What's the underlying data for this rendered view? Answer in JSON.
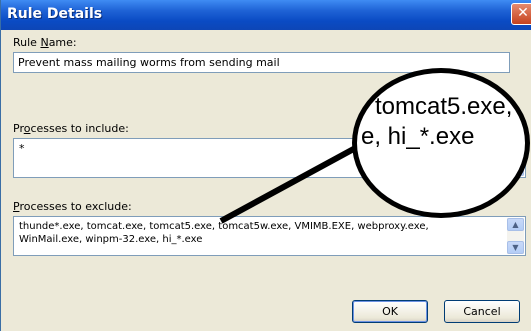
{
  "window": {
    "title": "Rule Details",
    "close_glyph": "✕"
  },
  "rule_name": {
    "label_prefix": "Rule ",
    "label_accel": "N",
    "label_suffix": "ame:",
    "value": "Prevent mass mailing worms from sending mail"
  },
  "include": {
    "label_prefix": "Pr",
    "label_accel": "o",
    "label_suffix": "cesses to include:",
    "value": "*"
  },
  "exclude": {
    "label_prefix": "",
    "label_accel": "P",
    "label_suffix": "rocesses to exclude:",
    "line1": "thunde*.exe, tomcat.exe, tomcat5.exe, tomcat5w.exe, VMIMB.EXE, webproxy.exe,",
    "line2": "WinMail.exe, winpm-32.exe, hi_*.exe"
  },
  "zoom": {
    "line1": "tomcat5.exe,",
    "line2": "e, hi_*.exe"
  },
  "buttons": {
    "ok": "OK",
    "cancel": "Cancel"
  },
  "icons": {
    "scroll_up": "▲",
    "scroll_down": "▼"
  },
  "colors": {
    "titlebar": "#0a4bc4",
    "dialog_bg": "#ece9d8",
    "close_button": "#c6421e"
  }
}
